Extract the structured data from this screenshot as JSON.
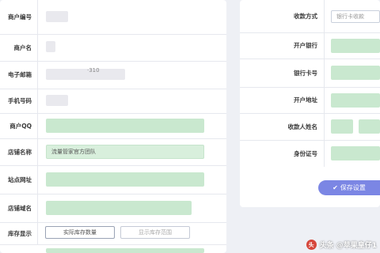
{
  "left_form": {
    "merchant_no_label": "商户编号",
    "merchant_name_label": "商户名",
    "email_label": "电子邮箱",
    "email_partial": "·310",
    "phone_label": "手机号码",
    "qq_label": "商户QQ",
    "shop_name_label": "店铺名称",
    "shop_name_value": "流量管家官方团队",
    "site_url_label": "站点网址",
    "shop_domain_label": "店铺域名",
    "stock_display_label": "库存显示",
    "stock_actual_option": "实际库存数量",
    "stock_range_option": "显示库存范围"
  },
  "right_form": {
    "payment_method_label": "收款方式",
    "payment_method_value": "银行卡收款",
    "bank_label": "开户银行",
    "card_no_label": "银行卡号",
    "bank_address_label": "开户地址",
    "payee_name_label": "收款人姓名",
    "id_no_label": "身份证号"
  },
  "actions": {
    "save_label": "保存设置",
    "save_icon": "check-icon"
  },
  "watermark": {
    "text": "头条 @苹果皇仔1",
    "brand_color": "#d6463b"
  },
  "colors": {
    "accent": "#7b86e4",
    "redacted_green": "#c9e8cf",
    "redacted_gray": "#e9e9ee"
  }
}
